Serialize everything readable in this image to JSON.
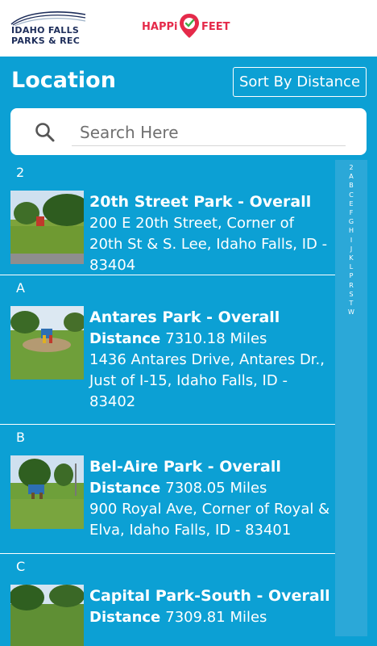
{
  "header": {
    "org_logo_line1": "IDAHO FALLS",
    "org_logo_line2": "PARKS & REC",
    "app_logo_left": "HAPPi",
    "app_logo_right": "FEET"
  },
  "page": {
    "title": "Location",
    "sort_button_label": "Sort By Distance"
  },
  "search": {
    "placeholder": "Search Here",
    "icon": "search-icon"
  },
  "sections": [
    {
      "header": "2",
      "items": [
        {
          "name": "20th Street Park - Overall",
          "distance_label": "",
          "distance_value": "",
          "address": "200 E 20th Street, Corner of 20th St & S. Lee, Idaho Falls, ID - 83404"
        }
      ]
    },
    {
      "header": "A",
      "items": [
        {
          "name": "Antares Park - Overall",
          "distance_label": "Distance",
          "distance_value": "7310.18 Miles",
          "address": "1436 Antares Drive, Antares Dr., Just of I-15, Idaho Falls, ID - 83402"
        }
      ]
    },
    {
      "header": "B",
      "items": [
        {
          "name": "Bel-Aire Park - Overall",
          "distance_label": "Distance",
          "distance_value": "7308.05 Miles",
          "address": "900 Royal Ave, Corner of Royal & Elva, Idaho Falls, ID - 83401"
        }
      ]
    },
    {
      "header": "C",
      "items": [
        {
          "name": "Capital Park-South - Overall",
          "distance_label": "Distance",
          "distance_value": "7309.81 Miles",
          "address": ""
        }
      ]
    }
  ],
  "index_letters": [
    "2",
    "A",
    "B",
    "C",
    "E",
    "F",
    "G",
    "H",
    "I",
    "J",
    "K",
    "L",
    "P",
    "R",
    "S",
    "T",
    "W"
  ],
  "colors": {
    "accent": "#0ca0d4",
    "index_bar": "#2ba8d8",
    "brand_navy": "#1d2d5a",
    "brand_red": "#e52a4a"
  }
}
